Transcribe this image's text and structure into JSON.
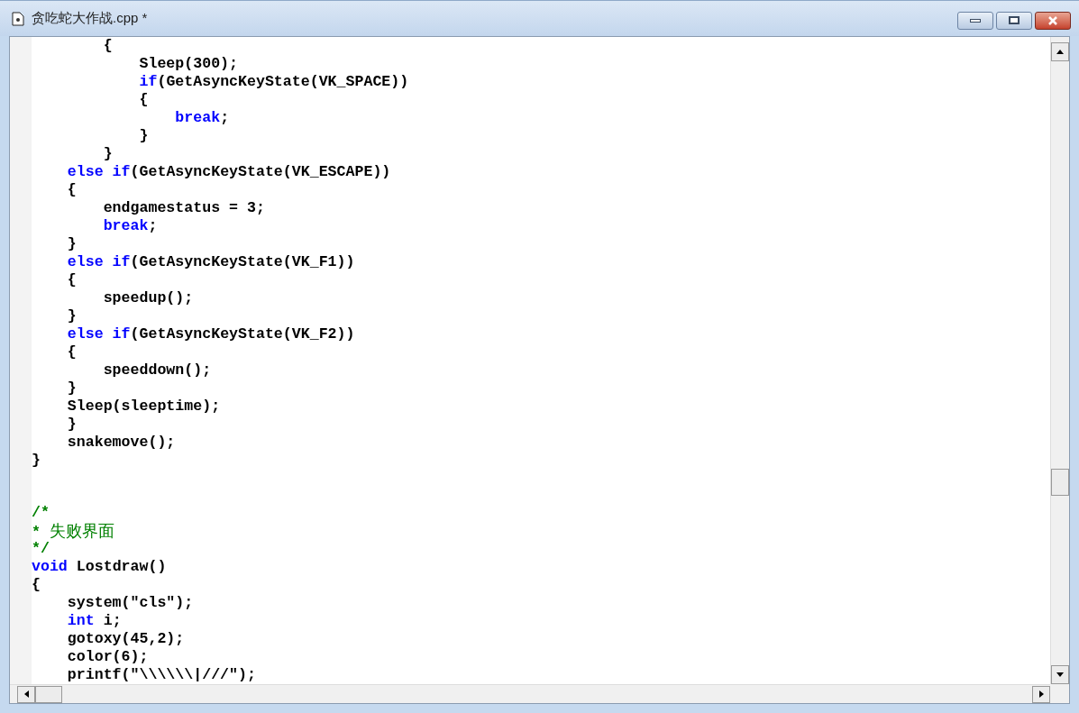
{
  "window": {
    "title": "贪吃蛇大作战.cpp *"
  },
  "editor": {
    "lines": [
      {
        "kind": "code",
        "tokens": [
          {
            "text": "        {",
            "kind": "plain"
          }
        ]
      },
      {
        "kind": "code",
        "tokens": [
          {
            "text": "            Sleep(300);",
            "kind": "plain"
          }
        ]
      },
      {
        "kind": "code",
        "tokens": [
          {
            "text": "            if",
            "kind": "keyword"
          },
          {
            "text": "(GetAsyncKeyState(VK_SPACE))",
            "kind": "plain"
          }
        ]
      },
      {
        "kind": "code",
        "tokens": [
          {
            "text": "            {",
            "kind": "plain"
          }
        ]
      },
      {
        "kind": "code",
        "tokens": [
          {
            "text": "                break",
            "kind": "keyword"
          },
          {
            "text": ";",
            "kind": "plain"
          }
        ]
      },
      {
        "kind": "code",
        "tokens": [
          {
            "text": "            }",
            "kind": "plain"
          }
        ]
      },
      {
        "kind": "code",
        "tokens": [
          {
            "text": "        }",
            "kind": "plain"
          }
        ]
      },
      {
        "kind": "code",
        "tokens": [
          {
            "text": "    else if",
            "kind": "keyword"
          },
          {
            "text": "(GetAsyncKeyState(VK_ESCAPE))",
            "kind": "plain"
          }
        ]
      },
      {
        "kind": "code",
        "tokens": [
          {
            "text": "    {",
            "kind": "plain"
          }
        ]
      },
      {
        "kind": "code",
        "tokens": [
          {
            "text": "        endgamestatus = 3;",
            "kind": "plain"
          }
        ]
      },
      {
        "kind": "code",
        "tokens": [
          {
            "text": "        break",
            "kind": "keyword"
          },
          {
            "text": ";",
            "kind": "plain"
          }
        ]
      },
      {
        "kind": "code",
        "tokens": [
          {
            "text": "    }",
            "kind": "plain"
          }
        ]
      },
      {
        "kind": "code",
        "tokens": [
          {
            "text": "    else if",
            "kind": "keyword"
          },
          {
            "text": "(GetAsyncKeyState(VK_F1))",
            "kind": "plain"
          }
        ]
      },
      {
        "kind": "code",
        "tokens": [
          {
            "text": "    {",
            "kind": "plain"
          }
        ]
      },
      {
        "kind": "code",
        "tokens": [
          {
            "text": "        speedup();",
            "kind": "plain"
          }
        ]
      },
      {
        "kind": "code",
        "tokens": [
          {
            "text": "    }",
            "kind": "plain"
          }
        ]
      },
      {
        "kind": "code",
        "tokens": [
          {
            "text": "    else if",
            "kind": "keyword"
          },
          {
            "text": "(GetAsyncKeyState(VK_F2))",
            "kind": "plain"
          }
        ]
      },
      {
        "kind": "code",
        "tokens": [
          {
            "text": "    {",
            "kind": "plain"
          }
        ]
      },
      {
        "kind": "code",
        "tokens": [
          {
            "text": "        speeddown();",
            "kind": "plain"
          }
        ]
      },
      {
        "kind": "code",
        "tokens": [
          {
            "text": "    }",
            "kind": "plain"
          }
        ]
      },
      {
        "kind": "code",
        "tokens": [
          {
            "text": "    Sleep(sleeptime);",
            "kind": "plain"
          }
        ]
      },
      {
        "kind": "code",
        "tokens": [
          {
            "text": "    }",
            "kind": "plain"
          }
        ]
      },
      {
        "kind": "code",
        "tokens": [
          {
            "text": "    snakemove();",
            "kind": "plain"
          }
        ]
      },
      {
        "kind": "code",
        "tokens": [
          {
            "text": "}",
            "kind": "plain"
          }
        ]
      },
      {
        "kind": "blank"
      },
      {
        "kind": "blank"
      },
      {
        "kind": "code",
        "tokens": [
          {
            "text": "/*",
            "kind": "comment"
          }
        ]
      },
      {
        "kind": "code",
        "tokens": [
          {
            "text": "* ",
            "kind": "comment"
          },
          {
            "text": "失败界面",
            "kind": "comment_cjk"
          }
        ]
      },
      {
        "kind": "code",
        "tokens": [
          {
            "text": "*/",
            "kind": "comment"
          }
        ]
      },
      {
        "kind": "code",
        "tokens": [
          {
            "text": "void",
            "kind": "keyword"
          },
          {
            "text": " Lostdraw()",
            "kind": "plain"
          }
        ]
      },
      {
        "kind": "code",
        "tokens": [
          {
            "text": "{",
            "kind": "plain"
          }
        ]
      },
      {
        "kind": "code",
        "tokens": [
          {
            "text": "    system(\"cls\");",
            "kind": "plain"
          }
        ]
      },
      {
        "kind": "code",
        "tokens": [
          {
            "text": "    int",
            "kind": "keyword"
          },
          {
            "text": " i;",
            "kind": "plain"
          }
        ]
      },
      {
        "kind": "code",
        "tokens": [
          {
            "text": "    gotoxy(45,2);",
            "kind": "plain"
          }
        ]
      },
      {
        "kind": "code",
        "tokens": [
          {
            "text": "    color(6);",
            "kind": "plain"
          }
        ]
      },
      {
        "kind": "code",
        "tokens": [
          {
            "text": "    printf(\"\\\\\\\\\\\\|///\");",
            "kind": "plain"
          }
        ]
      }
    ]
  }
}
